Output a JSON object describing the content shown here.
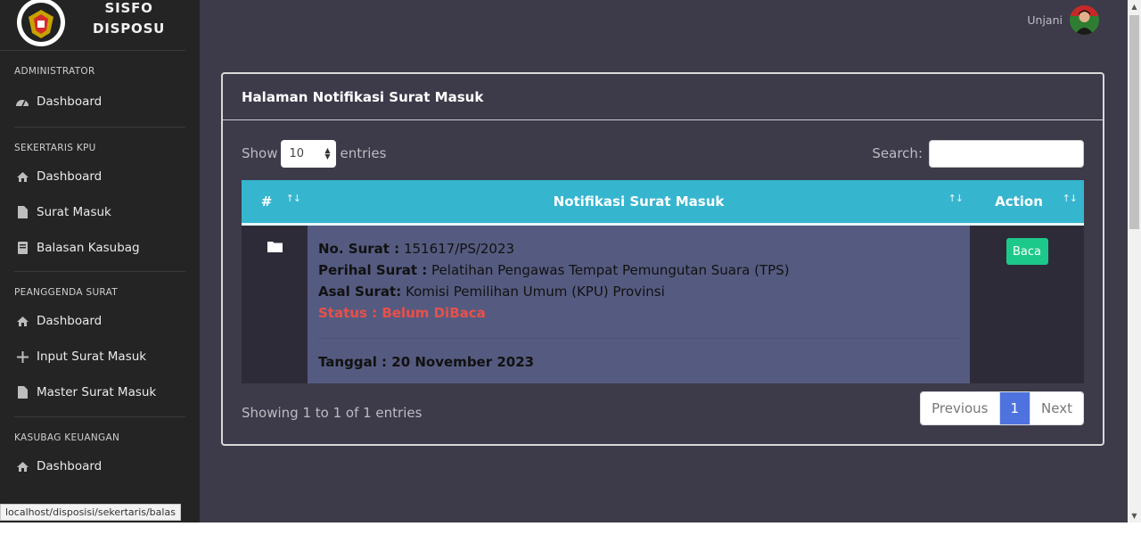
{
  "brand": {
    "line1": "SISFO",
    "line2": "DISPOSU"
  },
  "sidebar": {
    "sections": [
      {
        "heading": "ADMINISTRATOR",
        "items": [
          {
            "label": "Dashboard",
            "icon": "tachometer-icon"
          }
        ]
      },
      {
        "heading": "SEKERTARIS KPU",
        "items": [
          {
            "label": "Dashboard",
            "icon": "home-icon"
          },
          {
            "label": "Surat Masuk",
            "icon": "file-icon"
          },
          {
            "label": "Balasan Kasubag",
            "icon": "book-icon"
          }
        ]
      },
      {
        "heading": "PEANGGENDA SURAT",
        "items": [
          {
            "label": "Dashboard",
            "icon": "home-icon"
          },
          {
            "label": "Input Surat Masuk",
            "icon": "plus-icon"
          },
          {
            "label": "Master Surat Masuk",
            "icon": "file-icon"
          }
        ]
      },
      {
        "heading": "KASUBAG KEUANGAN",
        "items": [
          {
            "label": "Dashboard",
            "icon": "home-icon"
          }
        ]
      }
    ]
  },
  "topbar": {
    "user_name": "Unjani"
  },
  "card": {
    "title": "Halaman Notifikasi Surat Masuk"
  },
  "controls": {
    "show_label": "Show",
    "entries_value": "10",
    "entries_label": "entries",
    "search_label": "Search:"
  },
  "table": {
    "headers": {
      "num": "#",
      "notif": "Notifikasi Surat Masuk",
      "action": "Action"
    },
    "row": {
      "no_surat_label": "No. Surat :",
      "no_surat": "151617/PS/2023",
      "perihal_label": "Perihal Surat :",
      "perihal": "Pelatihan Pengawas Tempat Pemungutan Suara (TPS)",
      "asal_label": "Asal Surat:",
      "asal": "Komisi Pemilihan Umum (KPU) Provinsi",
      "status": "Status : Belum DiBaca",
      "tanggal": "Tanggal : 20 November 2023",
      "action_label": "Baca"
    }
  },
  "footer": {
    "info": "Showing 1 to 1 of 1 entries"
  },
  "pagination": {
    "prev": "Previous",
    "page": "1",
    "next": "Next"
  },
  "status_url": "localhost/disposisi/sekertaris/balas",
  "colors": {
    "sidebar_bg": "#242424",
    "content_bg": "#3d3a4a",
    "table_head": "#36b5cf",
    "notif_cell": "#555b80",
    "status_red": "#e8504a",
    "baca_green": "#1dc98a",
    "page_active": "#4e73df"
  }
}
